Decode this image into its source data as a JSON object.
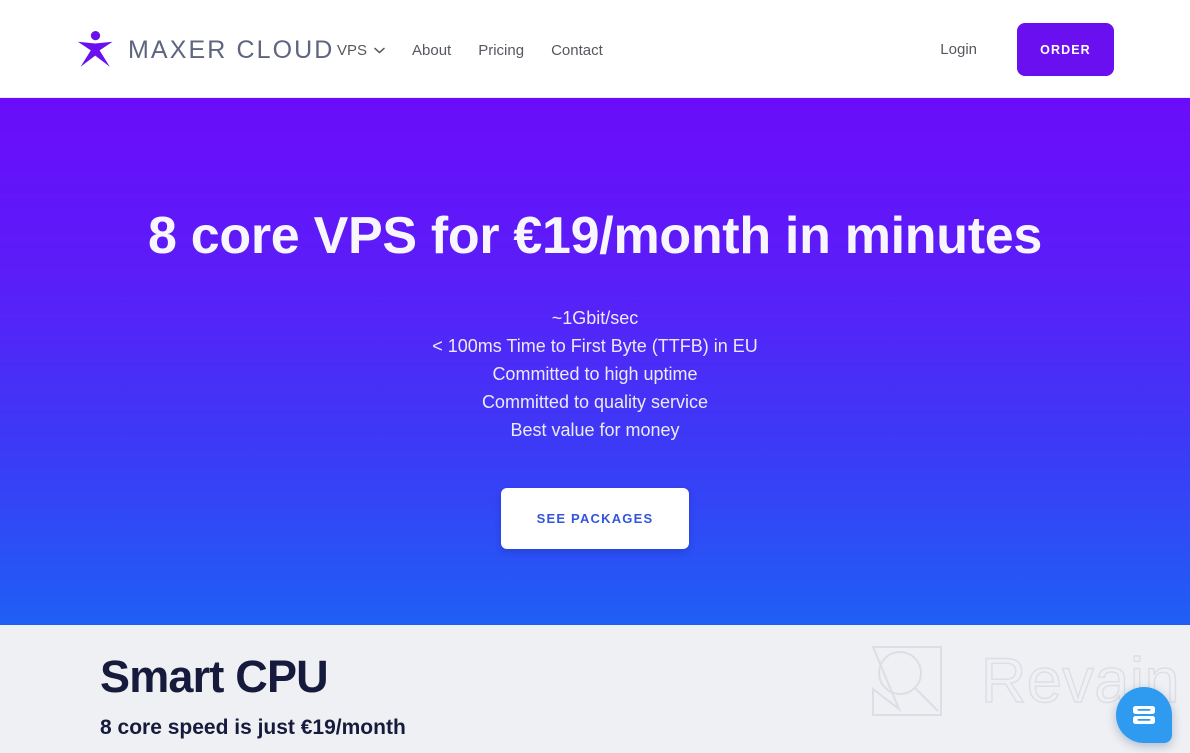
{
  "header": {
    "brand": {
      "mark_icon": "maxer-star-person-icon",
      "name": "MAXER CLOUD",
      "mark_color": "#6a10f0",
      "name_color": "#5d6580"
    },
    "nav": [
      {
        "label": "VPS",
        "has_dropdown": true,
        "dropdown_icon": "chevron-down-icon"
      },
      {
        "label": "About",
        "has_dropdown": false
      },
      {
        "label": "Pricing",
        "has_dropdown": false
      },
      {
        "label": "Contact",
        "has_dropdown": false
      }
    ],
    "login_label": "Login",
    "order_label": "ORDER",
    "order_color": "#6a10f0"
  },
  "hero": {
    "title": "8 core VPS for €19/month in minutes",
    "lines": [
      "~1Gbit/sec",
      "< 100ms Time to First Byte (TTFB) in EU",
      "Committed to high uptime",
      "Committed to quality service",
      "Best value for money"
    ],
    "cta_label": "SEE PACKAGES",
    "cta_text_color": "#3355dd",
    "gradient_from": "#6a0cfa",
    "gradient_to": "#1f5ff5"
  },
  "feature": {
    "title": "Smart CPU",
    "subtitle": "8 core speed is just €19/month",
    "background": "#eff0f3",
    "text_color": "#161a3c"
  },
  "watermark": {
    "text": "Revain",
    "mark_icon": "revain-logo-icon",
    "stroke_color": "#dcdee4"
  },
  "chat_widget": {
    "icon": "chat-bubble-icon",
    "color": "#2e9bf0"
  }
}
